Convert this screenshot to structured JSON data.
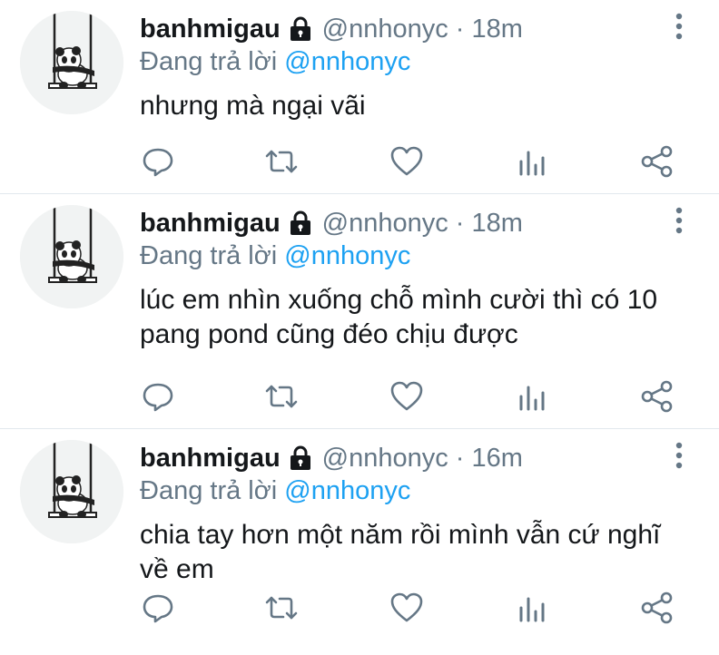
{
  "tweets": [
    {
      "name": "banhmigau",
      "handle": "@nnhonyc",
      "separator": "·",
      "time": "18m",
      "reply_prefix": "Đang trả lời",
      "reply_to": "@nnhonyc",
      "text": "nhưng mà ngại vãi"
    },
    {
      "name": "banhmigau",
      "handle": "@nnhonyc",
      "separator": "·",
      "time": "18m",
      "reply_prefix": "Đang trả lời",
      "reply_to": "@nnhonyc",
      "text": "lúc em nhìn xuống chỗ mình cười thì có 10 pang pond cũng đéo chịu được"
    },
    {
      "name": "banhmigau",
      "handle": "@nnhonyc",
      "separator": "·",
      "time": "16m",
      "reply_prefix": "Đang trả lời",
      "reply_to": "@nnhonyc",
      "text": "chia tay hơn một năm rồi mình vẫn cứ nghĩ về em"
    }
  ],
  "icons": {
    "lock": "lock-icon",
    "more": "more-vertical-icon",
    "reply": "reply-icon",
    "retweet": "retweet-icon",
    "like": "heart-icon",
    "stats": "analytics-icon",
    "share": "share-icon"
  },
  "colors": {
    "text": "#14171a",
    "secondary": "#657786",
    "link": "#1da1f2",
    "divider": "#e1e8ed"
  }
}
